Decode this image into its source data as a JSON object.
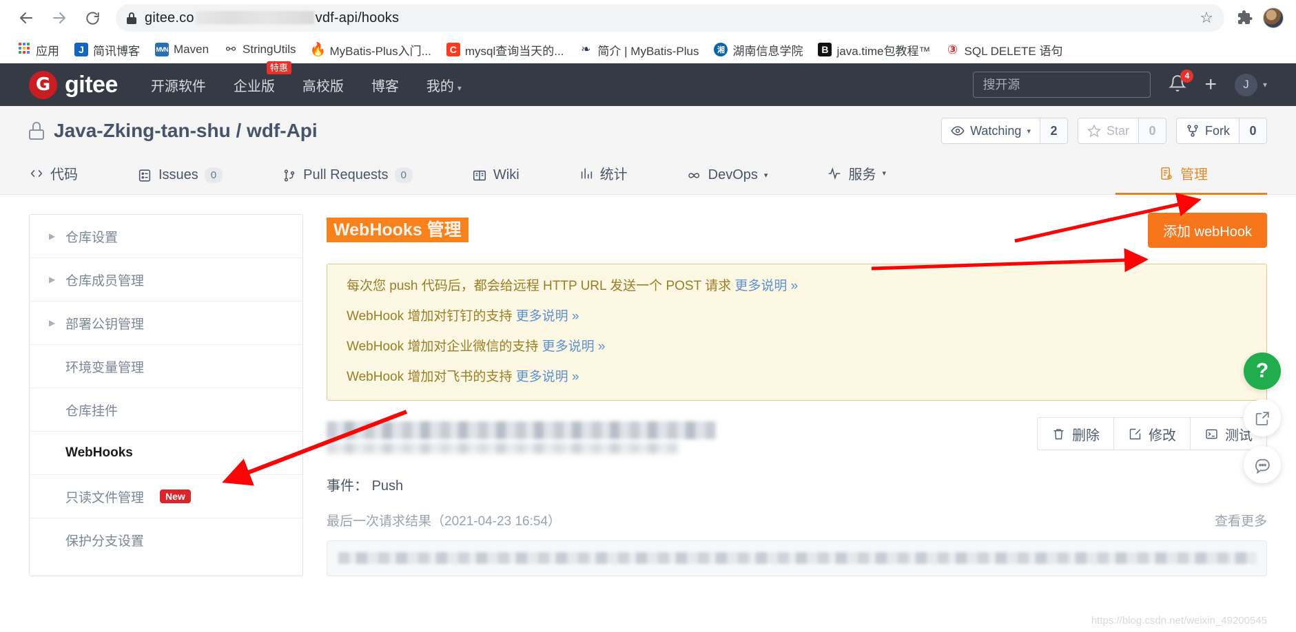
{
  "browser": {
    "back_icon": "arrow-left-icon",
    "forward_icon": "arrow-right-icon",
    "reload_icon": "reload-icon",
    "lock_icon": "lock-icon",
    "url_prefix": "gitee.co",
    "url_suffix": "vdf-api/hooks",
    "bookmark_star_icon": "star-outline-icon",
    "extensions_icon": "puzzle-piece-icon",
    "bookmarks": [
      {
        "label": "应用",
        "icon": "apps-grid-icon"
      },
      {
        "label": "简讯博客",
        "icon": "letter-j-icon"
      },
      {
        "label": "Maven",
        "icon": "maven-icon"
      },
      {
        "label": "StringUtils",
        "icon": "stringutils-icon"
      },
      {
        "label": "MyBatis-Plus入门...",
        "icon": "flame-icon"
      },
      {
        "label": "mysql查询当天的...",
        "icon": "letter-c-icon"
      },
      {
        "label": "简介 | MyBatis-Plus",
        "icon": "mybatis-plus-icon"
      },
      {
        "label": "湖南信息学院",
        "icon": "school-seal-icon"
      },
      {
        "label": "java.time包教程™",
        "icon": "letter-b-icon"
      },
      {
        "label": "SQL DELETE 语句",
        "icon": "runoob-icon"
      }
    ]
  },
  "gitee_header": {
    "logo_letter": "G",
    "logo_text": "gitee",
    "nav": [
      {
        "label": "开源软件",
        "badge": "",
        "caret": false
      },
      {
        "label": "企业版",
        "badge": "特惠",
        "caret": false
      },
      {
        "label": "高校版",
        "badge": "",
        "caret": false
      },
      {
        "label": "博客",
        "badge": "",
        "caret": false
      },
      {
        "label": "我的",
        "badge": "",
        "caret": true
      }
    ],
    "search_placeholder": "搜开源",
    "notification_icon": "bell-icon",
    "notification_count": "4",
    "add_icon": "plus-icon",
    "avatar_letter": "J",
    "avatar_caret_icon": "chevron-down-icon"
  },
  "repo": {
    "lock_icon": "lock-icon",
    "title": "Java-Zking-tan-shu / wdf-Api",
    "watch": {
      "icon": "eye-icon",
      "label": "Watching",
      "count": "2"
    },
    "star": {
      "icon": "star-icon",
      "label": "Star",
      "count": "0"
    },
    "fork": {
      "icon": "fork-icon",
      "label": "Fork",
      "count": "0"
    },
    "tabs": [
      {
        "label": "代码",
        "icon": "code-icon",
        "count": "",
        "caret": false,
        "active": false
      },
      {
        "label": "Issues",
        "icon": "issues-icon",
        "count": "0",
        "caret": false,
        "active": false
      },
      {
        "label": "Pull Requests",
        "icon": "pull-request-icon",
        "count": "0",
        "caret": false,
        "active": false
      },
      {
        "label": "Wiki",
        "icon": "wiki-icon",
        "count": "",
        "caret": false,
        "active": false
      },
      {
        "label": "统计",
        "icon": "chart-icon",
        "count": "",
        "caret": false,
        "active": false
      },
      {
        "label": "DevOps",
        "icon": "infinity-icon",
        "count": "",
        "caret": true,
        "active": false
      },
      {
        "label": "服务",
        "icon": "pulse-icon",
        "count": "",
        "caret": true,
        "active": false
      },
      {
        "label": "管理",
        "icon": "manage-icon",
        "count": "",
        "caret": false,
        "active": true
      }
    ]
  },
  "sidebar": {
    "items": [
      {
        "label": "仓库设置",
        "expandable": true,
        "active": false,
        "tag": ""
      },
      {
        "label": "仓库成员管理",
        "expandable": true,
        "active": false,
        "tag": ""
      },
      {
        "label": "部署公钥管理",
        "expandable": true,
        "active": false,
        "tag": ""
      },
      {
        "label": "环境变量管理",
        "expandable": false,
        "active": false,
        "tag": ""
      },
      {
        "label": "仓库挂件",
        "expandable": false,
        "active": false,
        "tag": ""
      },
      {
        "label": "WebHooks",
        "expandable": false,
        "active": true,
        "tag": ""
      },
      {
        "label": "只读文件管理",
        "expandable": false,
        "active": false,
        "tag": "New"
      },
      {
        "label": "保护分支设置",
        "expandable": false,
        "active": false,
        "tag": ""
      }
    ]
  },
  "main": {
    "page_title": "WebHooks 管理",
    "add_button": "添加 webHook",
    "notice": [
      {
        "text": "每次您 push 代码后，都会给远程 HTTP URL 发送一个 POST 请求 ",
        "link": "更多说明 »"
      },
      {
        "text": "WebHook 增加对钉钉的支持 ",
        "link": "更多说明 »"
      },
      {
        "text": "WebHook 增加对企业微信的支持 ",
        "link": "更多说明 »"
      },
      {
        "text": "WebHook 增加对飞书的支持 ",
        "link": "更多说明 »"
      }
    ],
    "hook": {
      "url_redacted": true,
      "actions": [
        {
          "label": "删除",
          "icon": "trash-icon"
        },
        {
          "label": "修改",
          "icon": "edit-icon"
        },
        {
          "label": "测试",
          "icon": "terminal-icon"
        }
      ],
      "event_label": "事件：",
      "event_value": "Push",
      "last_result": "最后一次请求结果（2021-04-23 16:54）",
      "view_more": "查看更多"
    },
    "watermark": "https://blog.csdn.net/weixin_49200545"
  },
  "floating": [
    {
      "icon": "question-mark-icon",
      "label": "?"
    },
    {
      "icon": "share-icon",
      "label": ""
    },
    {
      "icon": "feedback-icon",
      "label": ""
    }
  ]
}
